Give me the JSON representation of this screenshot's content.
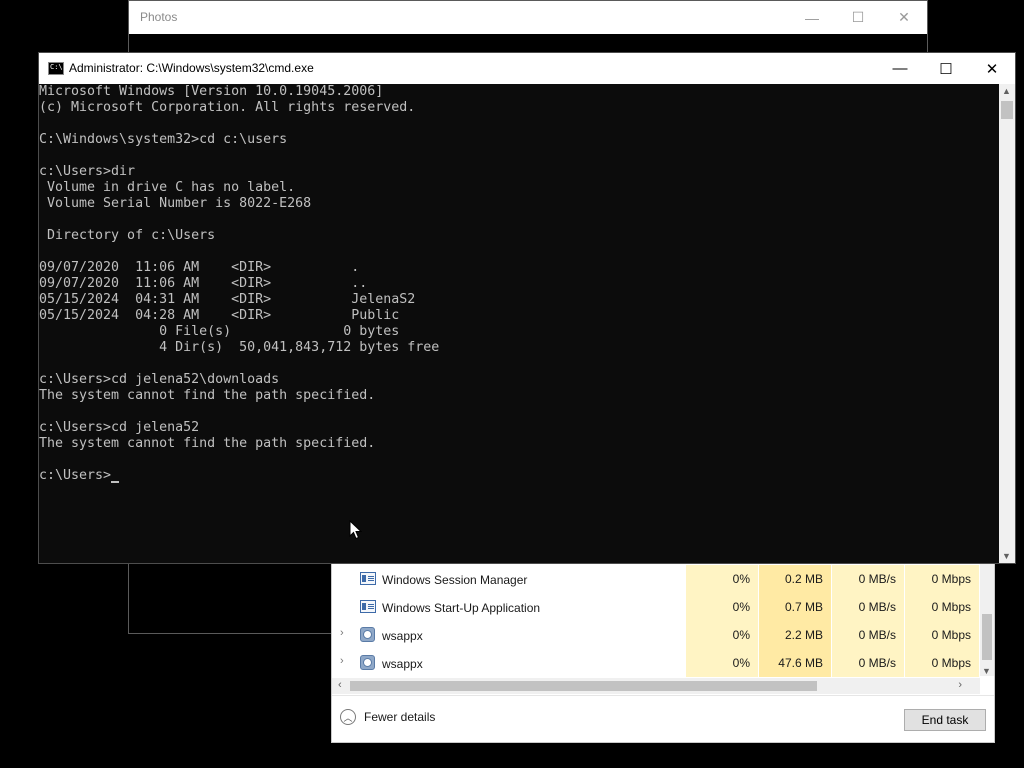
{
  "photos": {
    "title": "Photos",
    "controls": [
      "—",
      "☐",
      "✕"
    ]
  },
  "cmd": {
    "title": "Administrator: C:\\Windows\\system32\\cmd.exe",
    "controls": [
      "—",
      "☐",
      "✕"
    ],
    "lines": [
      "Microsoft Windows [Version 10.0.19045.2006]",
      "(c) Microsoft Corporation. All rights reserved.",
      "",
      "C:\\Windows\\system32>cd c:\\users",
      "",
      "c:\\Users>dir",
      " Volume in drive C has no label.",
      " Volume Serial Number is 8022-E268",
      "",
      " Directory of c:\\Users",
      "",
      "09/07/2020  11:06 AM    <DIR>          .",
      "09/07/2020  11:06 AM    <DIR>          ..",
      "05/15/2024  04:31 AM    <DIR>          JelenaS2",
      "05/15/2024  04:28 AM    <DIR>          Public",
      "               0 File(s)              0 bytes",
      "               4 Dir(s)  50,041,843,712 bytes free",
      "",
      "c:\\Users>cd jelena52\\downloads",
      "The system cannot find the path specified.",
      "",
      "c:\\Users>cd jelena52",
      "The system cannot find the path specified.",
      ""
    ],
    "prompt": "c:\\Users>"
  },
  "taskmgr": {
    "rows": [
      {
        "expander": "",
        "icon": "window-icon",
        "name": "Windows Session Manager",
        "cpu": "0%",
        "memory": "0.2 MB",
        "disk": "0 MB/s",
        "network": "0 Mbps"
      },
      {
        "expander": "",
        "icon": "window-icon",
        "name": "Windows Start-Up Application",
        "cpu": "0%",
        "memory": "0.7 MB",
        "disk": "0 MB/s",
        "network": "0 Mbps"
      },
      {
        "expander": "›",
        "icon": "gear-icon",
        "name": "wsappx",
        "cpu": "0%",
        "memory": "2.2 MB",
        "disk": "0 MB/s",
        "network": "0 Mbps"
      },
      {
        "expander": "›",
        "icon": "gear-icon",
        "name": "wsappx",
        "cpu": "0%",
        "memory": "47.6 MB",
        "disk": "0 MB/s",
        "network": "0 Mbps"
      }
    ],
    "fewer_details_label": "Fewer details",
    "end_task_label": "End task"
  }
}
